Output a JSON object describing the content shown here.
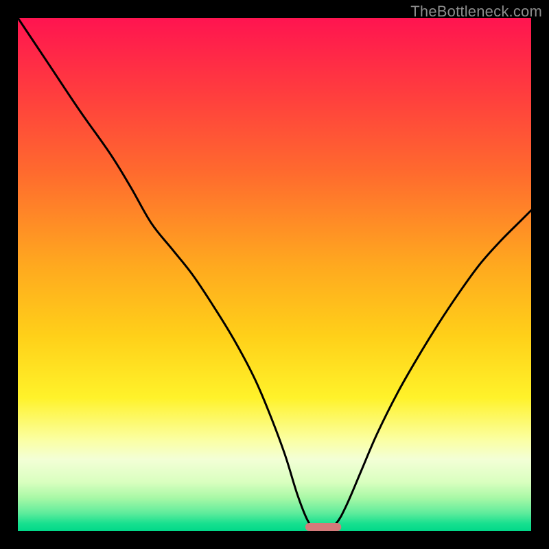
{
  "watermark": "TheBottleneck.com",
  "chart_data": {
    "type": "line",
    "title": "",
    "xlabel": "",
    "ylabel": "",
    "xlim": [
      0,
      100
    ],
    "ylim": [
      0,
      100
    ],
    "series": [
      {
        "name": "curve",
        "x": [
          0,
          6,
          12,
          18,
          22,
          26,
          30,
          34,
          38,
          42,
          46,
          49,
          52,
          54.5,
          56.5,
          58,
          60,
          62,
          64,
          67,
          70,
          74,
          78,
          82,
          86,
          90,
          94,
          98,
          100
        ],
        "y": [
          100,
          91,
          82,
          73.5,
          67,
          60,
          55,
          50,
          44,
          37.5,
          30,
          23,
          15,
          7,
          2,
          0.5,
          0.5,
          1.5,
          5,
          12,
          19,
          27,
          34,
          40.5,
          46.5,
          52,
          56.5,
          60.5,
          62.5
        ]
      }
    ],
    "marker": {
      "x_start": 56,
      "x_end": 63,
      "y": 0.8,
      "color": "#d47a7a"
    },
    "gradient_stops": [
      {
        "offset": 0.0,
        "color": "#ff1450"
      },
      {
        "offset": 0.14,
        "color": "#ff3b3f"
      },
      {
        "offset": 0.3,
        "color": "#ff6a2e"
      },
      {
        "offset": 0.48,
        "color": "#ffa81f"
      },
      {
        "offset": 0.62,
        "color": "#ffd019"
      },
      {
        "offset": 0.74,
        "color": "#fff22a"
      },
      {
        "offset": 0.82,
        "color": "#fbffa0"
      },
      {
        "offset": 0.86,
        "color": "#f3ffd6"
      },
      {
        "offset": 0.905,
        "color": "#d9ffbf"
      },
      {
        "offset": 0.935,
        "color": "#a8f8a6"
      },
      {
        "offset": 0.965,
        "color": "#5eec9c"
      },
      {
        "offset": 0.985,
        "color": "#18e08f"
      },
      {
        "offset": 1.0,
        "color": "#00d989"
      }
    ]
  }
}
